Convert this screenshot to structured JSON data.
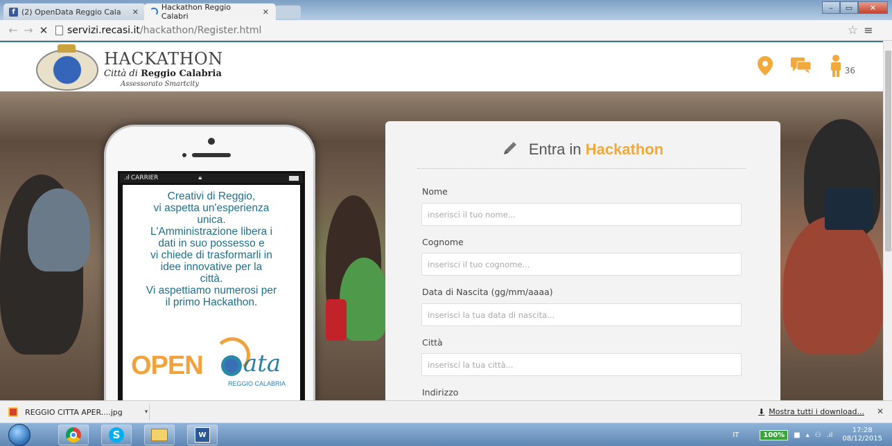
{
  "browser": {
    "tabs": [
      {
        "label": "(2) OpenData Reggio Cala"
      },
      {
        "label": "Hackathon Reggio Calabri"
      }
    ],
    "url_host": "servizi.recasi.it",
    "url_path": "/hackathon/Register.html"
  },
  "header": {
    "title": "HACKATHON",
    "city_prefix": "Città di",
    "city_name": "Reggio Calabria",
    "subtitle": "Assessorato Smartcity",
    "user_count": "36",
    "accent_color": "#f0a93a"
  },
  "phone": {
    "carrier": "CARRIER",
    "promo_lines": [
      "Creativi di Reggio,",
      "vi aspetta un'esperienza",
      "unica.",
      "L'Amministrazione libera i",
      "dati in suo possesso e",
      "vi chiede di trasformarli in",
      "idee innovative per la",
      "città.",
      "Vi aspettiamo numerosi per",
      "il primo Hackathon."
    ],
    "logo_open": "OPEN",
    "logo_data": "ata",
    "logo_sub": "REGGIO CALABRIA"
  },
  "form": {
    "heading_prefix": "Entra in",
    "heading_highlight": "Hackathon",
    "fields": [
      {
        "label": "Nome",
        "placeholder": "inserisci il tuo nome..."
      },
      {
        "label": "Cognome",
        "placeholder": "inserisci il tuo cognome..."
      },
      {
        "label": "Data di Nascita (gg/mm/aaaa)",
        "placeholder": "inserisci la tua data di nascita..."
      },
      {
        "label": "Città",
        "placeholder": "inserisci la tua città..."
      },
      {
        "label": "Indirizzo",
        "placeholder": ""
      }
    ]
  },
  "downloads": {
    "file_name": "REGGIO CITTA APER....jpg",
    "show_all": "Mostra tutti i download..."
  },
  "taskbar": {
    "language": "IT",
    "battery": "100%",
    "time": "17:28",
    "date": "08/12/2015"
  }
}
